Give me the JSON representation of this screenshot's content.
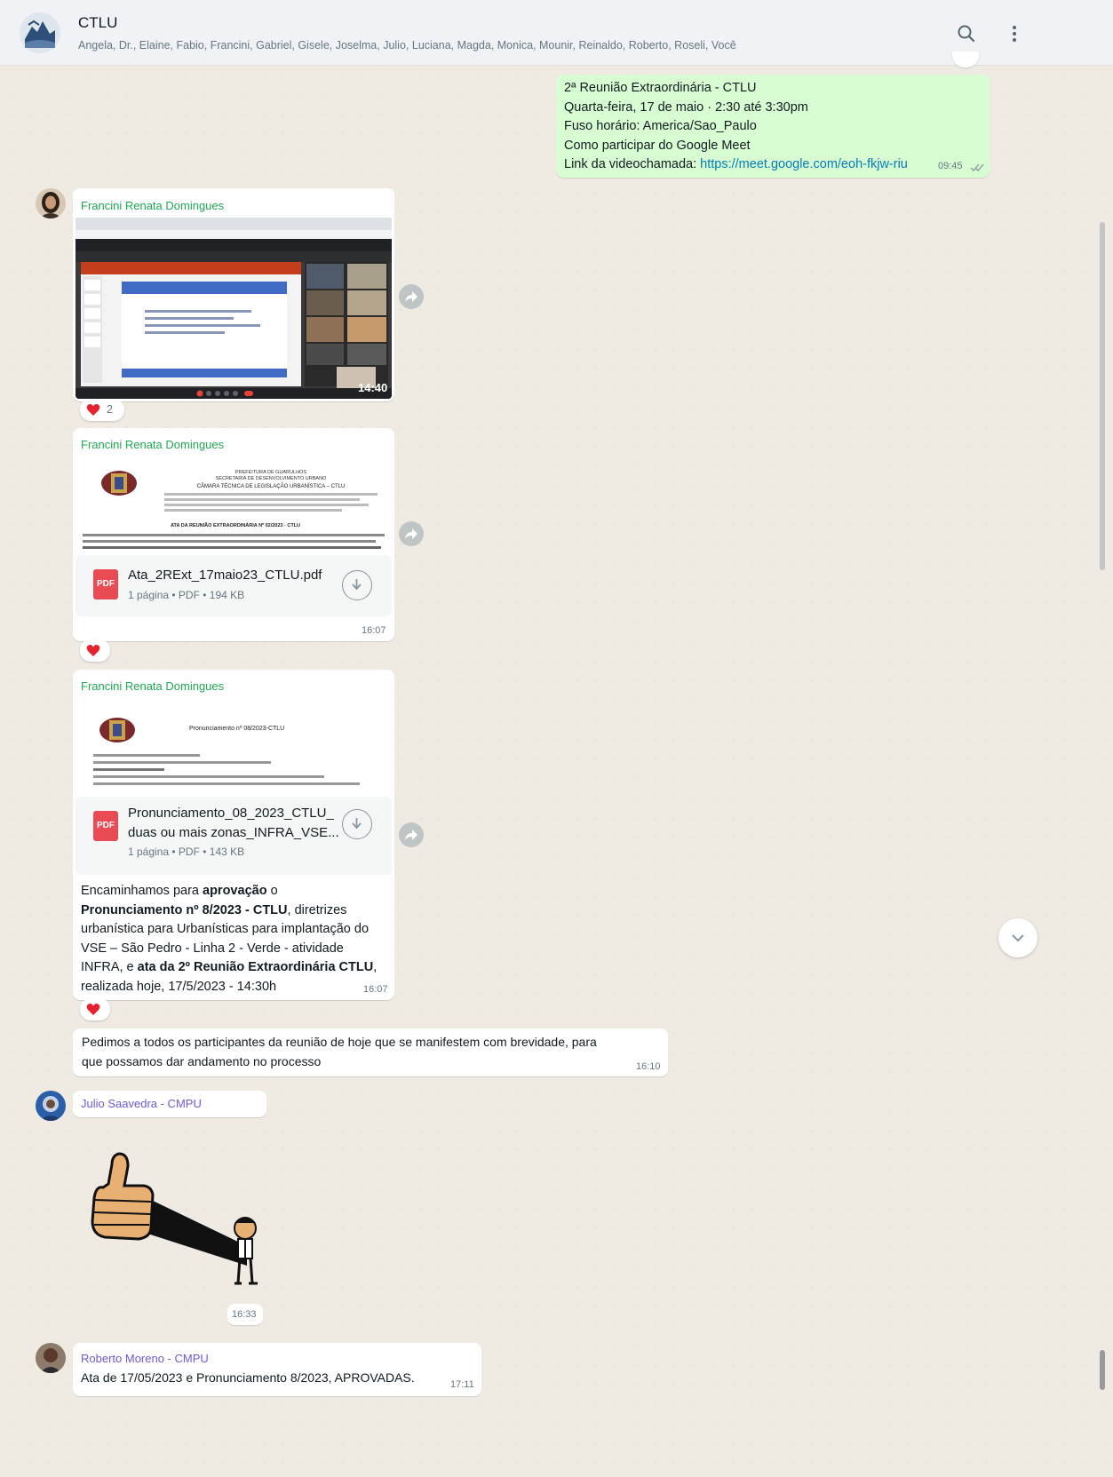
{
  "header": {
    "title": "CTLU",
    "members": "Angela, Dr., Elaine, Fabio, Francini, Gabriel, Gisele, Joselma, Julio, Luciana, Magda, Monica, Mounir, Reinaldo, Roberto, Roseli, Você",
    "icons": [
      "search-icon",
      "menu-icon"
    ]
  },
  "messages": {
    "meet_invite": {
      "line1": "2ª Reunião Extraordinária - CTLU",
      "line2": "Quarta-feira, 17 de maio · 2:30 até 3:30pm",
      "line3": "Fuso horário: America/Sao_Paulo",
      "line4": "Como participar do Google Meet",
      "line5_prefix": "Link da videochamada: ",
      "link": "https://meet.google.com/eoh-fkjw-riu",
      "time": "09:45"
    },
    "image_msg": {
      "sender": "Francini Renata Domingues",
      "image_time": "14:40",
      "reaction_count": "2"
    },
    "doc1": {
      "sender": "Francini Renata Domingues",
      "preview_header1": "PREFEITURA DE GUARULHOS",
      "preview_header2": "SECRETARIA DE DESENVOLVIMENTO URBANO",
      "preview_header3": "CÂMARA TÉCNICA DE LEGISLAÇÃO URBANÍSTICA – CTLU",
      "preview_title": "ATA DA REUNIÃO EXTRAORDINÁRIA Nº 02/2023 - CTLU",
      "file_name": "Ata_2RExt_17maio23_CTLU.pdf",
      "file_meta": "1 página • PDF • 194 KB",
      "time": "16:07"
    },
    "doc2": {
      "sender": "Francini Renata Domingues",
      "preview_title": "Pronunciamento nº 08/2023-CTLU",
      "file_name_line1": "Pronunciamento_08_2023_CTLU_",
      "file_name_line2": "duas ou mais zonas_INFRA_VSE...",
      "file_meta": "1 página • PDF • 143 KB",
      "caption_1": "Encaminhamos para ",
      "caption_bold1": "aprovação",
      "caption_2": " o",
      "caption_bold2": "Pronunciamento nº 8/2023 - CTLU",
      "caption_3": ",  diretrizes",
      "caption_line3": "urbanística para Urbanísticas para implantação do",
      "caption_line4": "VSE – São Pedro - Linha 2 - Verde - atividade",
      "caption_line5a": "INFRA, e ",
      "caption_bold3": "ata da 2º Reunião Extraordinária CTLU",
      "caption_line5b": ",",
      "caption_line6": "realizada hoje, 17/5/2023 - 14:30h",
      "time": "16:07"
    },
    "followup": {
      "line1": "Pedimos a todos os participantes da reunião de hoje que se manifestem com brevidade, para",
      "line2": "que possamos dar andamento no processo",
      "time": "16:10"
    },
    "julio": {
      "sender": "Julio Saavedra - CMPU",
      "sticker_time": "16:33"
    },
    "roberto": {
      "sender": "Roberto Moreno - CMPU",
      "text": "Ata de 17/05/2023 e Pronunciamento  8/2023, APROVADAS.",
      "time": "17:11"
    }
  },
  "colors": {
    "chat_bg": "#efeae2",
    "outgoing_bubble": "#d9fdd3",
    "sender_green": "#1fa855",
    "sender_purple": "#6b5bd6",
    "link": "#027eb5",
    "pdf_red": "#ea4a54",
    "read_ticks": "#53bdeb"
  }
}
